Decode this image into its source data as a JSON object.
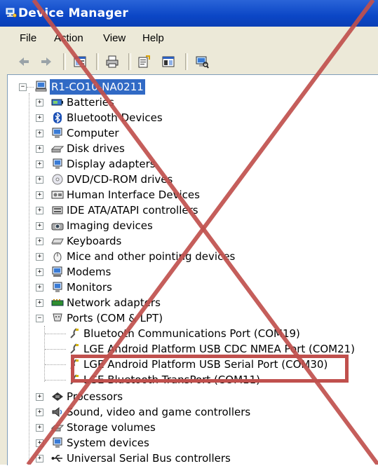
{
  "window": {
    "title": "Device Manager"
  },
  "menu": [
    {
      "label": "File",
      "key": "file"
    },
    {
      "label": "Action",
      "key": "action"
    },
    {
      "label": "View",
      "key": "view"
    },
    {
      "label": "Help",
      "key": "help"
    }
  ],
  "toolbar": {
    "buttons": [
      "back-icon",
      "forward-icon",
      "show-hide-tree-icon",
      "print-icon",
      "properties-icon",
      "help-pane-icon",
      "scan-hardware-icon"
    ]
  },
  "tree": {
    "root": "R1-CO10-NA0211",
    "categories": [
      "Batteries",
      "Bluetooth Devices",
      "Computer",
      "Disk drives",
      "Display adapters",
      "DVD/CD-ROM drives",
      "Human Interface Devices",
      "IDE ATA/ATAPI controllers",
      "Imaging devices",
      "Keyboards",
      "Mice and other pointing devices",
      "Modems",
      "Monitors",
      "Network adapters",
      "Ports (COM & LPT)"
    ],
    "ports": [
      "Bluetooth Communications Port (COM19)",
      "LGE Android Platform USB CDC NMEA Port (COM21)",
      "LGE Android Platform USB Serial Port (COM30)",
      "LGE Bluetooth TransPort (COM11)"
    ],
    "categories_after": [
      "Processors",
      "Sound, video and game controllers",
      "Storage volumes",
      "System devices",
      "Universal Serial Bus controllers"
    ]
  },
  "annotation": {
    "highlight_color": "#c0504d",
    "cross_color": "#c0504d"
  },
  "colors": {
    "title_bar": "#0b46c6",
    "selection": "#316ac5",
    "chrome": "#ece9d8"
  }
}
